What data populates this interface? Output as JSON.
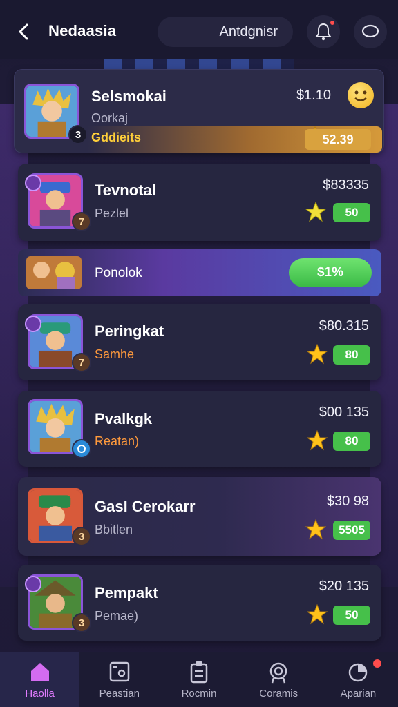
{
  "header": {
    "title": "Nedaasia",
    "search_text": "Antdgnisr"
  },
  "top_card": {
    "name": "Selsmokai",
    "sub": "Oorkaj",
    "tag": "Gddieits",
    "price": "$1.10",
    "score": "52.39",
    "level": "3"
  },
  "promo": {
    "label": "Ponolok",
    "button": "$1%"
  },
  "rows": [
    {
      "name": "Tevnotal",
      "sub": "Pezlel",
      "price": "$83335",
      "score": "50",
      "level": "7"
    },
    {
      "name": "Peringkat",
      "sub": "Samhe",
      "price": "$80.315",
      "score": "80",
      "level": "7"
    },
    {
      "name": "Pvalkgk",
      "sub": "Reatan)",
      "price": "$00 135",
      "score": "80",
      "level": ""
    },
    {
      "name": "Gasl Cerokarr",
      "sub": "Bbitlen",
      "price": "$30 98",
      "score": "5505",
      "level": "3"
    },
    {
      "name": "Pempakt",
      "sub": "Pemae)",
      "price": "$20 135",
      "score": "50",
      "level": "3"
    }
  ],
  "nav": [
    {
      "label": "Haolla",
      "icon": "home-icon"
    },
    {
      "label": "Peastian",
      "icon": "photo-icon"
    },
    {
      "label": "Rocmin",
      "icon": "clipboard-icon"
    },
    {
      "label": "Coramis",
      "icon": "badge-icon"
    },
    {
      "label": "Aparian",
      "icon": "profile-icon"
    }
  ],
  "colors": {
    "accent": "#e27cff",
    "score_green": "#46c04a",
    "star": "#ffc21a",
    "gold": "#d9a23e"
  }
}
